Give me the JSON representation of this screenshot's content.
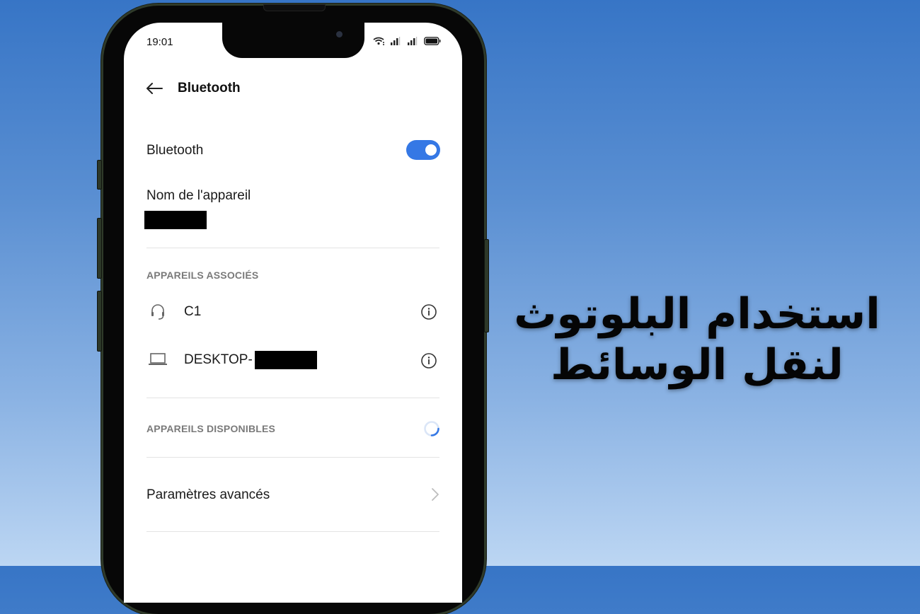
{
  "overlay": {
    "title": "استخدام البلوتوث لنقل الوسائط"
  },
  "status_bar": {
    "time": "19:01",
    "icons": [
      "wifi-icon",
      "signal-icon-sim1",
      "signal-icon-sim2",
      "battery-icon"
    ]
  },
  "header": {
    "back_icon": "arrow-left-icon",
    "title": "Bluetooth"
  },
  "bluetooth_toggle": {
    "label": "Bluetooth",
    "enabled": true,
    "accent_color": "#3578e5"
  },
  "device_name": {
    "label": "Nom de l'appareil",
    "value_redacted": true
  },
  "paired_devices": {
    "header": "APPAREILS ASSOCIÉS",
    "items": [
      {
        "icon": "headset-icon",
        "name": "C1",
        "action_icon": "info-icon"
      },
      {
        "icon": "laptop-icon",
        "name": "DESKTOP-",
        "name_suffix_redacted": true,
        "action_icon": "info-icon"
      }
    ]
  },
  "available_devices": {
    "header": "APPAREILS DISPONIBLES",
    "scanning": true
  },
  "advanced": {
    "label": "Paramètres avancés",
    "icon": "chevron-right-icon"
  }
}
